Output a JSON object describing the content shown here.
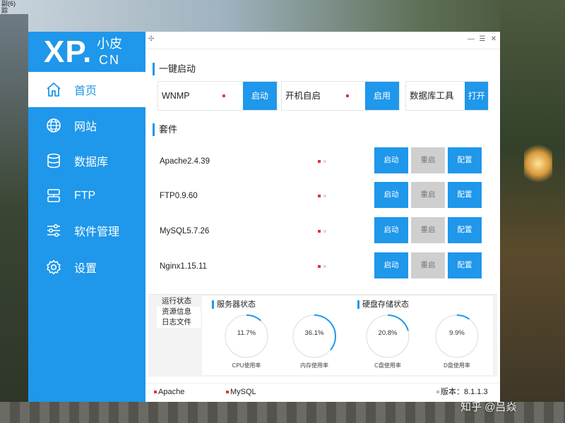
{
  "background": {
    "corner_text": [
      "副(6)",
      "踪"
    ],
    "watermark": "知乎 @吕焱"
  },
  "app": {
    "logo": {
      "main": "XP.",
      "sub1": "小皮",
      "sub2": "CN"
    },
    "accent_color": "#1f97ea",
    "status_red": "#e0343d"
  },
  "titlebar": {
    "app_icon": "✣",
    "minimize": "—",
    "maximize": "☰",
    "close": "✕"
  },
  "sidebar": {
    "items": [
      {
        "label": "首页",
        "icon": "home-icon",
        "active": true
      },
      {
        "label": "网站",
        "icon": "globe-icon",
        "active": false
      },
      {
        "label": "数据库",
        "icon": "database-icon",
        "active": false
      },
      {
        "label": "FTP",
        "icon": "ftp-icon",
        "active": false
      },
      {
        "label": "软件管理",
        "icon": "sliders-icon",
        "active": false
      },
      {
        "label": "设置",
        "icon": "gear-icon",
        "active": false
      }
    ]
  },
  "quick_start": {
    "title": "一键启动",
    "items": [
      {
        "label": "WNMP",
        "button": "启动"
      },
      {
        "label": "开机自启",
        "button": "启用"
      },
      {
        "label": "数据库工具",
        "button": "打开"
      }
    ]
  },
  "suite": {
    "title": "套件",
    "rows": [
      {
        "name": "Apache2.4.39",
        "start": "启动",
        "restart": "重启",
        "config": "配置"
      },
      {
        "name": "FTP0.9.60",
        "start": "启动",
        "restart": "重启",
        "config": "配置"
      },
      {
        "name": "MySQL5.7.26",
        "start": "启动",
        "restart": "重启",
        "config": "配置"
      },
      {
        "name": "Nginx1.15.11",
        "start": "启动",
        "restart": "重启",
        "config": "配置"
      }
    ]
  },
  "status_panel": {
    "tabs": [
      "运行状态",
      "资源信息",
      "日志文件"
    ],
    "server_title": "服务器状态",
    "disk_title": "硬盘存储状态",
    "gauges": [
      {
        "value": "11.7%",
        "fraction": 0.117,
        "caption": "CPU使用率"
      },
      {
        "value": "36.1%",
        "fraction": 0.361,
        "caption": "内存使用率"
      },
      {
        "value": "20.8%",
        "fraction": 0.208,
        "caption": "C盘使用率"
      },
      {
        "value": "9.9%",
        "fraction": 0.099,
        "caption": "D盘使用率"
      }
    ]
  },
  "statusbar": {
    "apache": "Apache",
    "mysql": "MySQL",
    "version": "版本：8.1.1.3"
  }
}
